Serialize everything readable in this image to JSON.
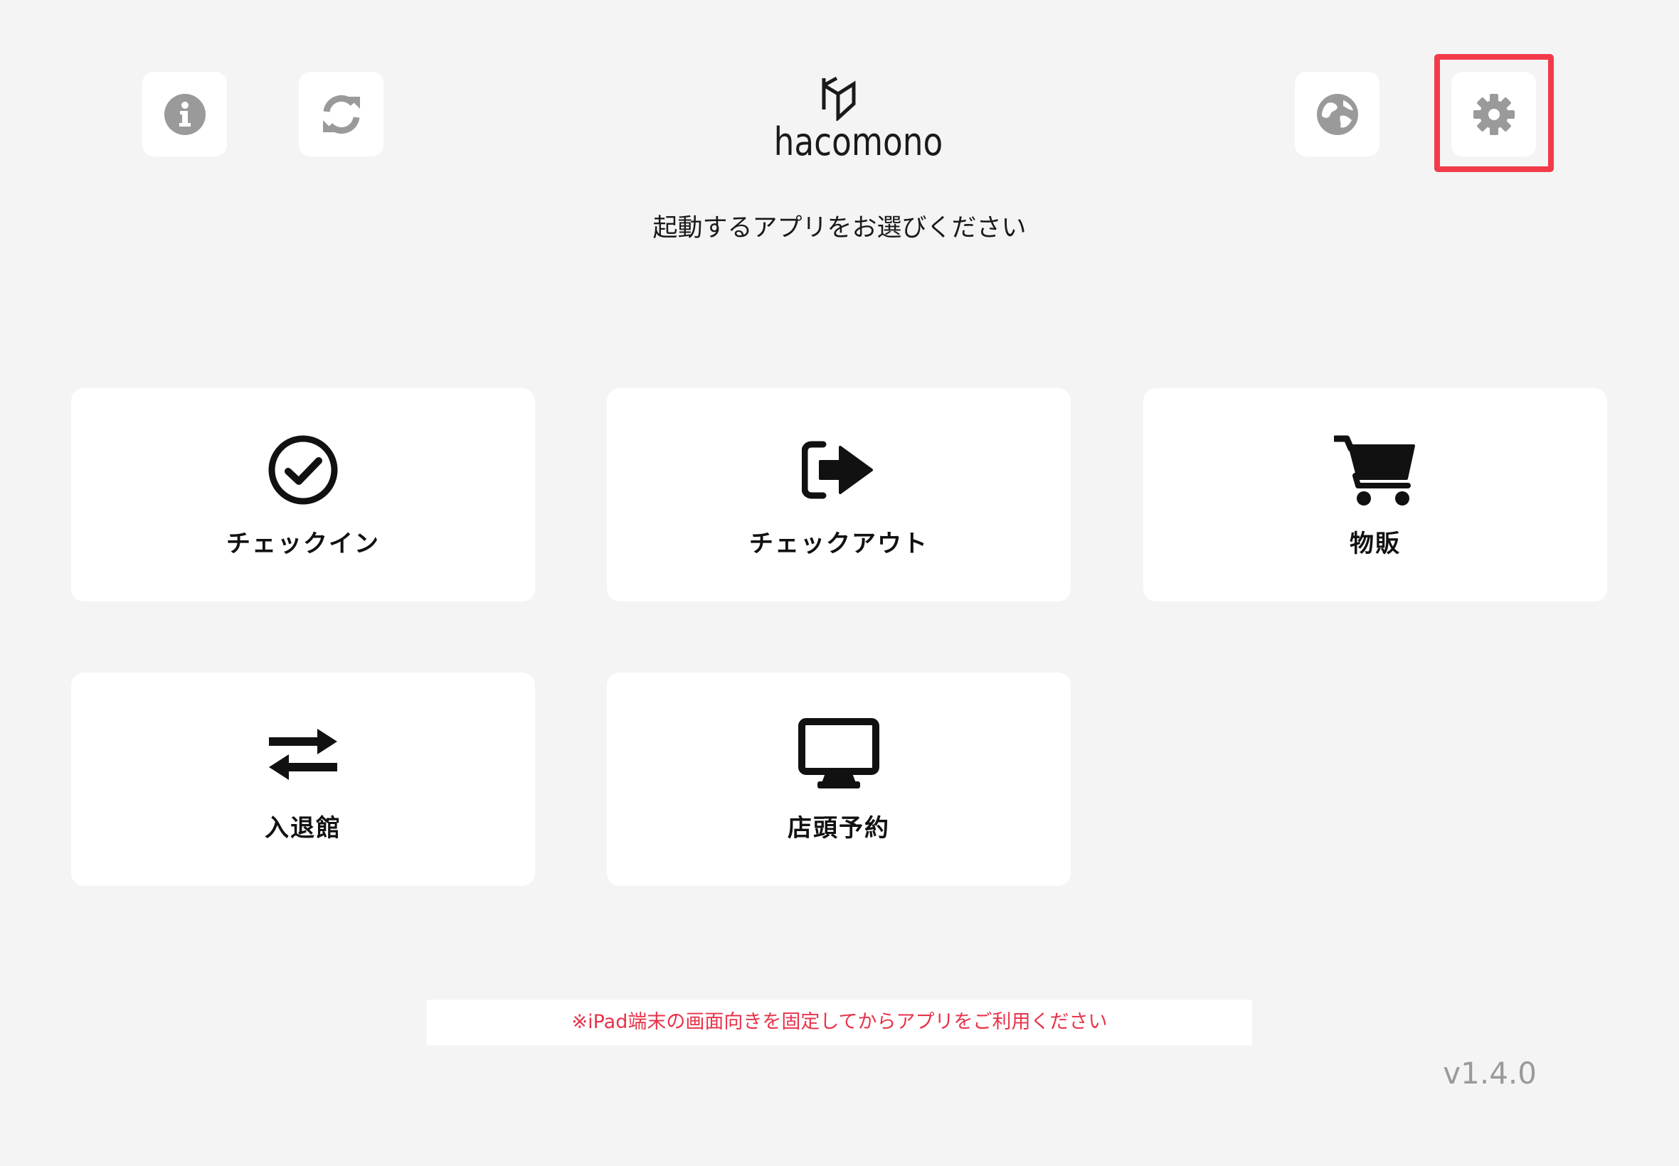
{
  "header": {
    "info_icon": "info-circle-icon",
    "refresh_icon": "sync-icon",
    "globe_icon": "globe-icon",
    "settings_icon": "gear-icon",
    "logo_text": "hacomono"
  },
  "subtitle": "起動するアプリをお選びください",
  "apps": [
    {
      "label": "チェックイン",
      "icon": "check-circle-icon"
    },
    {
      "label": "チェックアウト",
      "icon": "sign-out-icon"
    },
    {
      "label": "物販",
      "icon": "shopping-cart-icon"
    },
    {
      "label": "入退館",
      "icon": "exchange-arrows-icon"
    },
    {
      "label": "店頭予約",
      "icon": "desktop-monitor-icon"
    }
  ],
  "notice": "※iPad端末の画面向きを固定してからアプリをご利用ください",
  "version": "v1.4.0",
  "colors": {
    "background": "#f4f4f4",
    "icon_gray": "#9a9a9a",
    "highlight": "#f23b4a",
    "notice_text": "#e8334a"
  }
}
